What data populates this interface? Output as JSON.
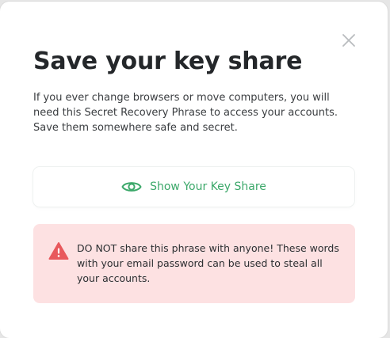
{
  "modal": {
    "title": "Save your key share",
    "description": "If you ever change browsers or move computers, you will need this Secret Recovery Phrase to access your accounts. Save them somewhere safe and secret.",
    "close_icon": "close-icon",
    "show_button": {
      "label": "Show Your Key Share",
      "icon": "eye-icon"
    },
    "warning": {
      "icon": "warning-triangle-icon",
      "text": "DO NOT share this phrase with anyone! These words with your email password can be used to steal all your accounts."
    }
  },
  "colors": {
    "accent_green": "#3ca86a",
    "warning_bg": "#fde1e2",
    "warning_icon": "#e8585c",
    "title": "#24272a"
  }
}
